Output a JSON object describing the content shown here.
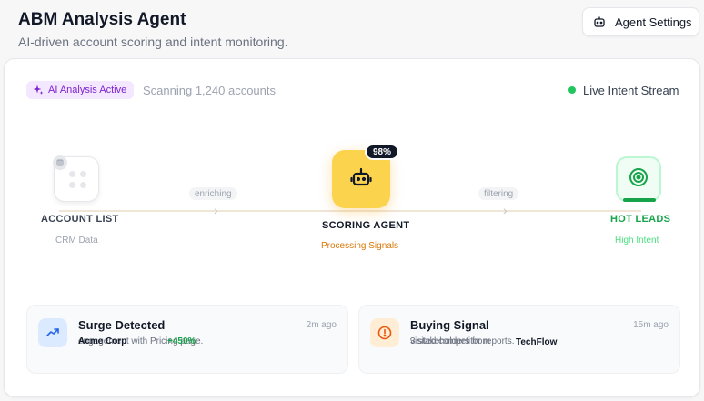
{
  "header": {
    "title": "ABM Analysis Agent",
    "subtitle": "AI-driven account scoring and intent monitoring.",
    "settings_label": "Agent Settings"
  },
  "status": {
    "badge": "AI Analysis Active",
    "scanning": "Scanning 1,240 accounts",
    "live": "Live Intent Stream"
  },
  "flow": {
    "enriching": "enriching",
    "filtering": "filtering",
    "source": {
      "title": "ACCOUNT LIST",
      "sub": "CRM Data"
    },
    "agent": {
      "title": "SCORING AGENT",
      "sub": "Processing Signals",
      "score": "98%"
    },
    "target": {
      "title": "HOT LEADS",
      "sub": "High Intent"
    }
  },
  "signals": [
    {
      "title": "Surge Detected",
      "time": "2m ago",
      "desc": "engagement with Pricing page.",
      "company": "Acme Corp",
      "change": "+450%"
    },
    {
      "title": "Buying Signal",
      "time": "15m ago",
      "desc": "3 stakeholders from",
      "company": "TechFlow",
      "extra": "visited competitor reports."
    }
  ],
  "colors": {
    "accent_purple": "#7e22ce",
    "agent_yellow": "#fcd34d",
    "lead_green": "#16a34a"
  }
}
